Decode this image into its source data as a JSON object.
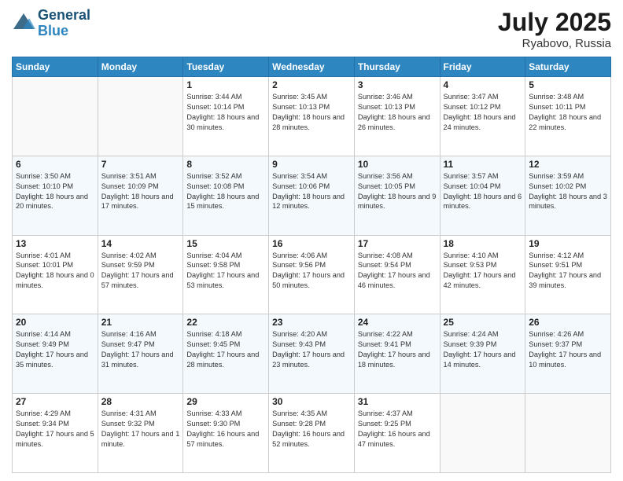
{
  "header": {
    "logo_line1": "General",
    "logo_line2": "Blue",
    "month_year": "July 2025",
    "location": "Ryabovo, Russia"
  },
  "weekdays": [
    "Sunday",
    "Monday",
    "Tuesday",
    "Wednesday",
    "Thursday",
    "Friday",
    "Saturday"
  ],
  "weeks": [
    [
      {
        "day": "",
        "text": ""
      },
      {
        "day": "",
        "text": ""
      },
      {
        "day": "1",
        "text": "Sunrise: 3:44 AM\nSunset: 10:14 PM\nDaylight: 18 hours and 30 minutes."
      },
      {
        "day": "2",
        "text": "Sunrise: 3:45 AM\nSunset: 10:13 PM\nDaylight: 18 hours and 28 minutes."
      },
      {
        "day": "3",
        "text": "Sunrise: 3:46 AM\nSunset: 10:13 PM\nDaylight: 18 hours and 26 minutes."
      },
      {
        "day": "4",
        "text": "Sunrise: 3:47 AM\nSunset: 10:12 PM\nDaylight: 18 hours and 24 minutes."
      },
      {
        "day": "5",
        "text": "Sunrise: 3:48 AM\nSunset: 10:11 PM\nDaylight: 18 hours and 22 minutes."
      }
    ],
    [
      {
        "day": "6",
        "text": "Sunrise: 3:50 AM\nSunset: 10:10 PM\nDaylight: 18 hours and 20 minutes."
      },
      {
        "day": "7",
        "text": "Sunrise: 3:51 AM\nSunset: 10:09 PM\nDaylight: 18 hours and 17 minutes."
      },
      {
        "day": "8",
        "text": "Sunrise: 3:52 AM\nSunset: 10:08 PM\nDaylight: 18 hours and 15 minutes."
      },
      {
        "day": "9",
        "text": "Sunrise: 3:54 AM\nSunset: 10:06 PM\nDaylight: 18 hours and 12 minutes."
      },
      {
        "day": "10",
        "text": "Sunrise: 3:56 AM\nSunset: 10:05 PM\nDaylight: 18 hours and 9 minutes."
      },
      {
        "day": "11",
        "text": "Sunrise: 3:57 AM\nSunset: 10:04 PM\nDaylight: 18 hours and 6 minutes."
      },
      {
        "day": "12",
        "text": "Sunrise: 3:59 AM\nSunset: 10:02 PM\nDaylight: 18 hours and 3 minutes."
      }
    ],
    [
      {
        "day": "13",
        "text": "Sunrise: 4:01 AM\nSunset: 10:01 PM\nDaylight: 18 hours and 0 minutes."
      },
      {
        "day": "14",
        "text": "Sunrise: 4:02 AM\nSunset: 9:59 PM\nDaylight: 17 hours and 57 minutes."
      },
      {
        "day": "15",
        "text": "Sunrise: 4:04 AM\nSunset: 9:58 PM\nDaylight: 17 hours and 53 minutes."
      },
      {
        "day": "16",
        "text": "Sunrise: 4:06 AM\nSunset: 9:56 PM\nDaylight: 17 hours and 50 minutes."
      },
      {
        "day": "17",
        "text": "Sunrise: 4:08 AM\nSunset: 9:54 PM\nDaylight: 17 hours and 46 minutes."
      },
      {
        "day": "18",
        "text": "Sunrise: 4:10 AM\nSunset: 9:53 PM\nDaylight: 17 hours and 42 minutes."
      },
      {
        "day": "19",
        "text": "Sunrise: 4:12 AM\nSunset: 9:51 PM\nDaylight: 17 hours and 39 minutes."
      }
    ],
    [
      {
        "day": "20",
        "text": "Sunrise: 4:14 AM\nSunset: 9:49 PM\nDaylight: 17 hours and 35 minutes."
      },
      {
        "day": "21",
        "text": "Sunrise: 4:16 AM\nSunset: 9:47 PM\nDaylight: 17 hours and 31 minutes."
      },
      {
        "day": "22",
        "text": "Sunrise: 4:18 AM\nSunset: 9:45 PM\nDaylight: 17 hours and 28 minutes."
      },
      {
        "day": "23",
        "text": "Sunrise: 4:20 AM\nSunset: 9:43 PM\nDaylight: 17 hours and 23 minutes."
      },
      {
        "day": "24",
        "text": "Sunrise: 4:22 AM\nSunset: 9:41 PM\nDaylight: 17 hours and 18 minutes."
      },
      {
        "day": "25",
        "text": "Sunrise: 4:24 AM\nSunset: 9:39 PM\nDaylight: 17 hours and 14 minutes."
      },
      {
        "day": "26",
        "text": "Sunrise: 4:26 AM\nSunset: 9:37 PM\nDaylight: 17 hours and 10 minutes."
      }
    ],
    [
      {
        "day": "27",
        "text": "Sunrise: 4:29 AM\nSunset: 9:34 PM\nDaylight: 17 hours and 5 minutes."
      },
      {
        "day": "28",
        "text": "Sunrise: 4:31 AM\nSunset: 9:32 PM\nDaylight: 17 hours and 1 minute."
      },
      {
        "day": "29",
        "text": "Sunrise: 4:33 AM\nSunset: 9:30 PM\nDaylight: 16 hours and 57 minutes."
      },
      {
        "day": "30",
        "text": "Sunrise: 4:35 AM\nSunset: 9:28 PM\nDaylight: 16 hours and 52 minutes."
      },
      {
        "day": "31",
        "text": "Sunrise: 4:37 AM\nSunset: 9:25 PM\nDaylight: 16 hours and 47 minutes."
      },
      {
        "day": "",
        "text": ""
      },
      {
        "day": "",
        "text": ""
      }
    ]
  ]
}
